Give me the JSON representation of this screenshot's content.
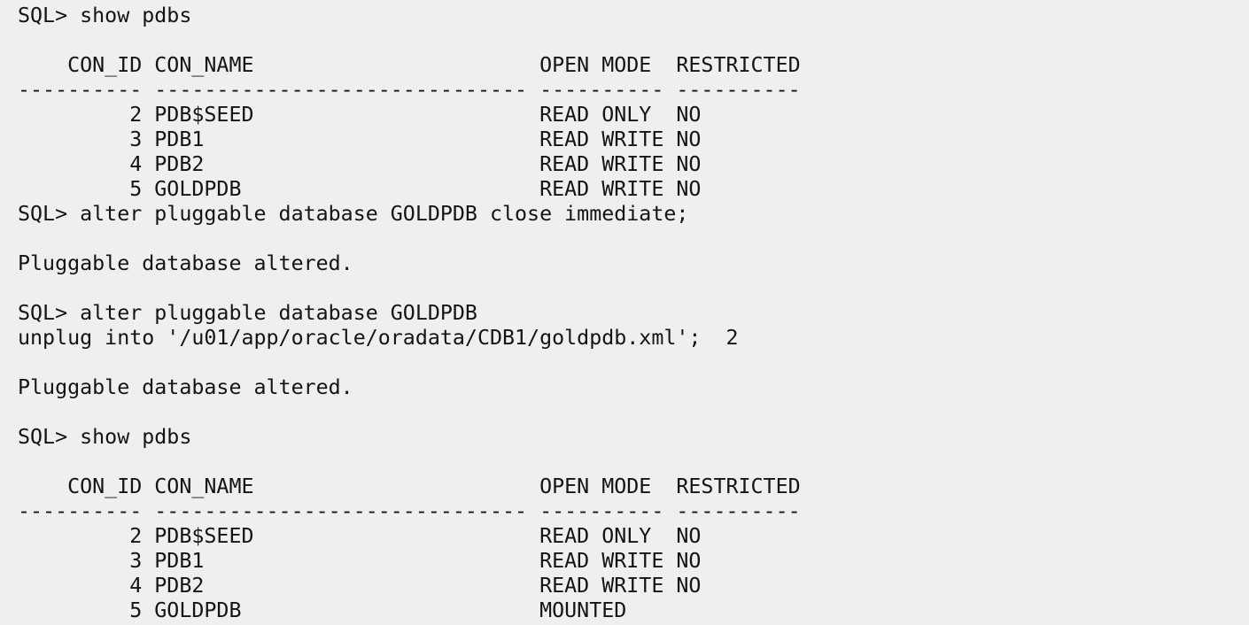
{
  "terminal": {
    "lines": [
      "SQL> show pdbs",
      "",
      "    CON_ID CON_NAME                       OPEN MODE  RESTRICTED",
      "---------- ------------------------------ ---------- ----------",
      "         2 PDB$SEED                       READ ONLY  NO",
      "         3 PDB1                           READ WRITE NO",
      "         4 PDB2                           READ WRITE NO",
      "         5 GOLDPDB                        READ WRITE NO",
      "SQL> alter pluggable database GOLDPDB close immediate;",
      "",
      "Pluggable database altered.",
      "",
      "SQL> alter pluggable database GOLDPDB",
      "unplug into '/u01/app/oracle/oradata/CDB1/goldpdb.xml';  2",
      "",
      "Pluggable database altered.",
      "",
      "SQL> show pdbs",
      "",
      "    CON_ID CON_NAME                       OPEN MODE  RESTRICTED",
      "---------- ------------------------------ ---------- ----------",
      "         2 PDB$SEED                       READ ONLY  NO",
      "         3 PDB1                           READ WRITE NO",
      "         4 PDB2                           READ WRITE NO",
      "         5 GOLDPDB                        MOUNTED"
    ]
  }
}
